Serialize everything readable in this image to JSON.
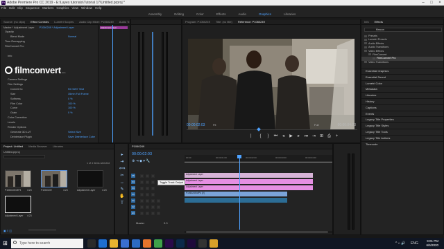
{
  "window": {
    "title": "Adobe Premiere Pro CC 2019 - E:\\Layes tutorials\\Tutorial 17\\Untitled.prproj *"
  },
  "menu": [
    "File",
    "Edit",
    "Clip",
    "Sequence",
    "Markers",
    "Graphics",
    "View",
    "Window",
    "Help"
  ],
  "workspaces": [
    {
      "label": "Assembly",
      "active": false
    },
    {
      "label": "Editing",
      "active": false
    },
    {
      "label": "Color",
      "active": false
    },
    {
      "label": "Effects",
      "active": false
    },
    {
      "label": "Audio",
      "active": false
    },
    {
      "label": "Graphics",
      "active": true
    },
    {
      "label": "Libraries",
      "active": false
    }
  ],
  "fx_tabs": [
    "Source: (no clips)",
    "Effect Controls",
    "Lumetri Scopes",
    "Audio Clip Mixer: P1060249",
    "Audio Track Mixer: P1060249"
  ],
  "fx_header": {
    "master": "Master * Adjustment Layer",
    "seq": "P1060249 * Adjustment Layer"
  },
  "fx_rows": [
    {
      "label": "Opacity",
      "value": "",
      "indent": 6,
      "reset": true
    },
    {
      "label": "Blend Mode",
      "value": "Normal",
      "indent": 14,
      "reset": false
    },
    {
      "label": "Time Remapping",
      "value": "",
      "indent": 6,
      "reset": false
    },
    {
      "label": "FilmConvert Pro",
      "value": "",
      "indent": 6,
      "reset": true
    },
    {
      "label": "",
      "value": "",
      "indent": 6,
      "reset": true
    },
    {
      "label": "Info",
      "value": "",
      "indent": 10,
      "reset": false
    },
    {
      "label": "",
      "value": "",
      "indent": 6,
      "reset": false
    },
    {
      "label": "",
      "value": "",
      "indent": 6,
      "reset": false
    },
    {
      "label": "",
      "value": "",
      "indent": 6,
      "reset": false
    },
    {
      "label": "",
      "value": "",
      "indent": 6,
      "reset": false
    },
    {
      "label": "Camera Settings",
      "value": "",
      "indent": 10,
      "reset": false
    },
    {
      "label": "Film Settings",
      "value": "",
      "indent": 10,
      "reset": false
    },
    {
      "label": "Convert to",
      "value": "KD 5207 Vis3",
      "indent": 14,
      "reset": true
    },
    {
      "label": "Size",
      "value": "35mm Full Frame",
      "indent": 14,
      "reset": true
    },
    {
      "label": "Softness",
      "value": "0 %",
      "indent": 14,
      "reset": true
    },
    {
      "label": "Film Color",
      "value": "100 %",
      "indent": 14,
      "reset": true
    },
    {
      "label": "Curve",
      "value": "100 %",
      "indent": 14,
      "reset": true
    },
    {
      "label": "Grain",
      "value": "0 %",
      "indent": 14,
      "reset": true
    },
    {
      "label": "Color Correction",
      "value": "",
      "indent": 10,
      "reset": false
    },
    {
      "label": "Levels",
      "value": "",
      "indent": 10,
      "reset": false
    },
    {
      "label": "Render Options",
      "value": "",
      "indent": 10,
      "reset": false
    },
    {
      "label": "Generate 3D LUT",
      "value": "Select Size",
      "indent": 14,
      "reset": false
    },
    {
      "label": "Deinterlace Plugin",
      "value": "Save Deinterlace Cube",
      "indent": 14,
      "reset": false
    }
  ],
  "filmconvert": {
    "logo": "filmconvert",
    "sub": ".com"
  },
  "fx_mini_clip": "Adjustment Layer",
  "program": {
    "tabs": [
      "Program: P1060249",
      "Title: (no title)",
      "Reference: P1060249"
    ],
    "time_left": "00:00:02:03",
    "time_right": "00:00:04:23",
    "fit": "Fit",
    "quality": "Full",
    "controls": [
      "⎸",
      "{",
      "}",
      "⏮",
      "◂",
      "▶",
      "▸",
      "⏭",
      "⇥",
      "⊞",
      "⎙",
      "+"
    ]
  },
  "effects": {
    "tabs": [
      "Info",
      "Effects"
    ],
    "search": "filmcon",
    "tree": [
      {
        "label": "Presets",
        "indent": 4,
        "sel": false
      },
      {
        "label": "Lumetri Presets",
        "indent": 4,
        "sel": false
      },
      {
        "label": "Audio Effects",
        "indent": 4,
        "sel": false
      },
      {
        "label": "Audio Transitions",
        "indent": 4,
        "sel": false
      },
      {
        "label": "Video Effects",
        "indent": 4,
        "sel": false
      },
      {
        "label": "FilmConvert",
        "indent": 10,
        "sel": false
      },
      {
        "label": "FilmConvert Pro",
        "indent": 16,
        "sel": true
      },
      {
        "label": "Video Transitions",
        "indent": 4,
        "sel": false
      }
    ],
    "sections": [
      "Essential Graphics",
      "Essential Sound",
      "Lumetri Color",
      "Metadata",
      "Libraries",
      "History",
      "Captions",
      "Events",
      "Legacy Title Properties",
      "Legacy Title Styles",
      "Legacy Title Tools",
      "Legacy Title Actions",
      "Timecode"
    ]
  },
  "project": {
    "tabs": [
      "Project: Untitled",
      "Media Browser",
      "Libraries"
    ],
    "file": "Untitled.prproj",
    "count": "1 of 4 items selected",
    "items": [
      {
        "name": "P1060249.MP4",
        "dur": "4:23"
      },
      {
        "name": "P1060249",
        "dur": "4:23"
      },
      {
        "name": "Adjustment Layer",
        "dur": "4:23"
      },
      {
        "name": "Adjustment Layer",
        "dur": "4:23"
      }
    ]
  },
  "tools": [
    "▸",
    "⇥",
    "⟺",
    "✂",
    "↔",
    "✎",
    "✋",
    "T"
  ],
  "timeline": {
    "tab": "P1060249",
    "time": "00:00:02:03",
    "ticks": [
      "00:00",
      "00:00:01:00",
      "00:00:02:00",
      "00:00:03:00",
      "00:00:04:00"
    ],
    "tooltip": "Toggle Track Output",
    "tracks": [
      {
        "name": "V5",
        "kind": "v",
        "clips": [
          {
            "label": "Adjustment Layer",
            "cls": "adj",
            "start": 0,
            "end": 185
          }
        ]
      },
      {
        "name": "V4",
        "kind": "v",
        "clips": [
          {
            "label": "Adjustment Layer",
            "cls": "pink",
            "start": 0,
            "end": 185
          }
        ]
      },
      {
        "name": "V3",
        "kind": "v",
        "clips": [
          {
            "label": "Adjustment Layer",
            "cls": "pink",
            "start": 0,
            "end": 185
          }
        ]
      },
      {
        "name": "V1",
        "kind": "v",
        "clips": [
          {
            "label": "P1060249.MP4 [V]",
            "cls": "vid",
            "start": 0,
            "end": 148
          }
        ]
      },
      {
        "name": "A1",
        "kind": "a",
        "clips": [
          {
            "label": "",
            "cls": "aud",
            "start": 0,
            "end": 148
          }
        ]
      },
      {
        "name": "A2",
        "kind": "a",
        "clips": []
      },
      {
        "name": "A3",
        "kind": "a",
        "clips": []
      },
      {
        "name": "Master",
        "kind": "m",
        "clips": []
      }
    ],
    "master_val": "0.0"
  },
  "taskbar": {
    "search": "Type here to search",
    "time": "9:01 PM",
    "date": "6/6/2020",
    "lang": "ENG",
    "apps": [
      {
        "name": "task-view",
        "color": "#2b2b2b"
      },
      {
        "name": "edge",
        "color": "#1f6fd1"
      },
      {
        "name": "file-explorer",
        "color": "#e6b22f"
      },
      {
        "name": "store",
        "color": "#3a6fd0"
      },
      {
        "name": "mail",
        "color": "#2d6bc3"
      },
      {
        "name": "firefox",
        "color": "#e8742c"
      },
      {
        "name": "chrome",
        "color": "#3fa14a"
      },
      {
        "name": "premiere",
        "color": "#2a0a4a"
      },
      {
        "name": "photoshop",
        "color": "#0b2a4a"
      },
      {
        "name": "after-effects",
        "color": "#1f0a3c"
      },
      {
        "name": "obs",
        "color": "#333333"
      },
      {
        "name": "explorer",
        "color": "#d9a12a"
      }
    ]
  }
}
